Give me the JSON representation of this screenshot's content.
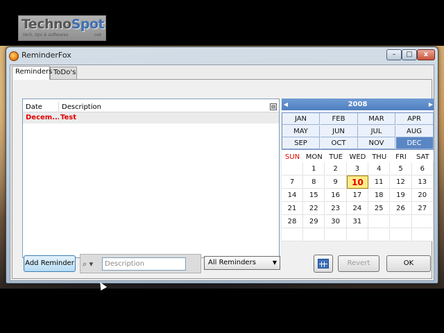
{
  "watermark": {
    "title_a": "Techno",
    "title_b": "Spot",
    "tagline": "tech, tips & softwares",
    "domain": ".net"
  },
  "window": {
    "title": "ReminderFox",
    "controls": {
      "minimize": "–",
      "maximize": "□",
      "close": "x"
    }
  },
  "tabs": [
    {
      "label": "Reminders",
      "active": true
    },
    {
      "label": "ToDo's",
      "active": false
    }
  ],
  "list": {
    "columns": {
      "date": "Date",
      "description": "Description"
    },
    "rows": [
      {
        "date": "Decem...",
        "description": "Test"
      }
    ]
  },
  "calendar": {
    "year": "2008",
    "prev_arrow": "◀",
    "next_arrow": "▶",
    "months": [
      "JAN",
      "FEB",
      "MAR",
      "APR",
      "MAY",
      "JUN",
      "JUL",
      "AUG",
      "SEP",
      "OCT",
      "NOV",
      "DEC"
    ],
    "selected_month": "DEC",
    "weekdays": [
      "SUN",
      "MON",
      "TUE",
      "WED",
      "THU",
      "FRI",
      "SAT"
    ],
    "first_weekday_index": 1,
    "days_in_month": 31,
    "today": 10
  },
  "bottom": {
    "add_reminder": "Add Reminder",
    "search_icon": "⌕ ▾",
    "search_placeholder": "Description",
    "filter_selected": "All Reminders",
    "filter_arrow": "▼",
    "revert": "Revert",
    "ok": "OK"
  },
  "colors": {
    "accent": "#4f7fc0",
    "reminder_text": "#e00000",
    "sunday": "#e00000",
    "today_bg": "#ffeb8a"
  }
}
